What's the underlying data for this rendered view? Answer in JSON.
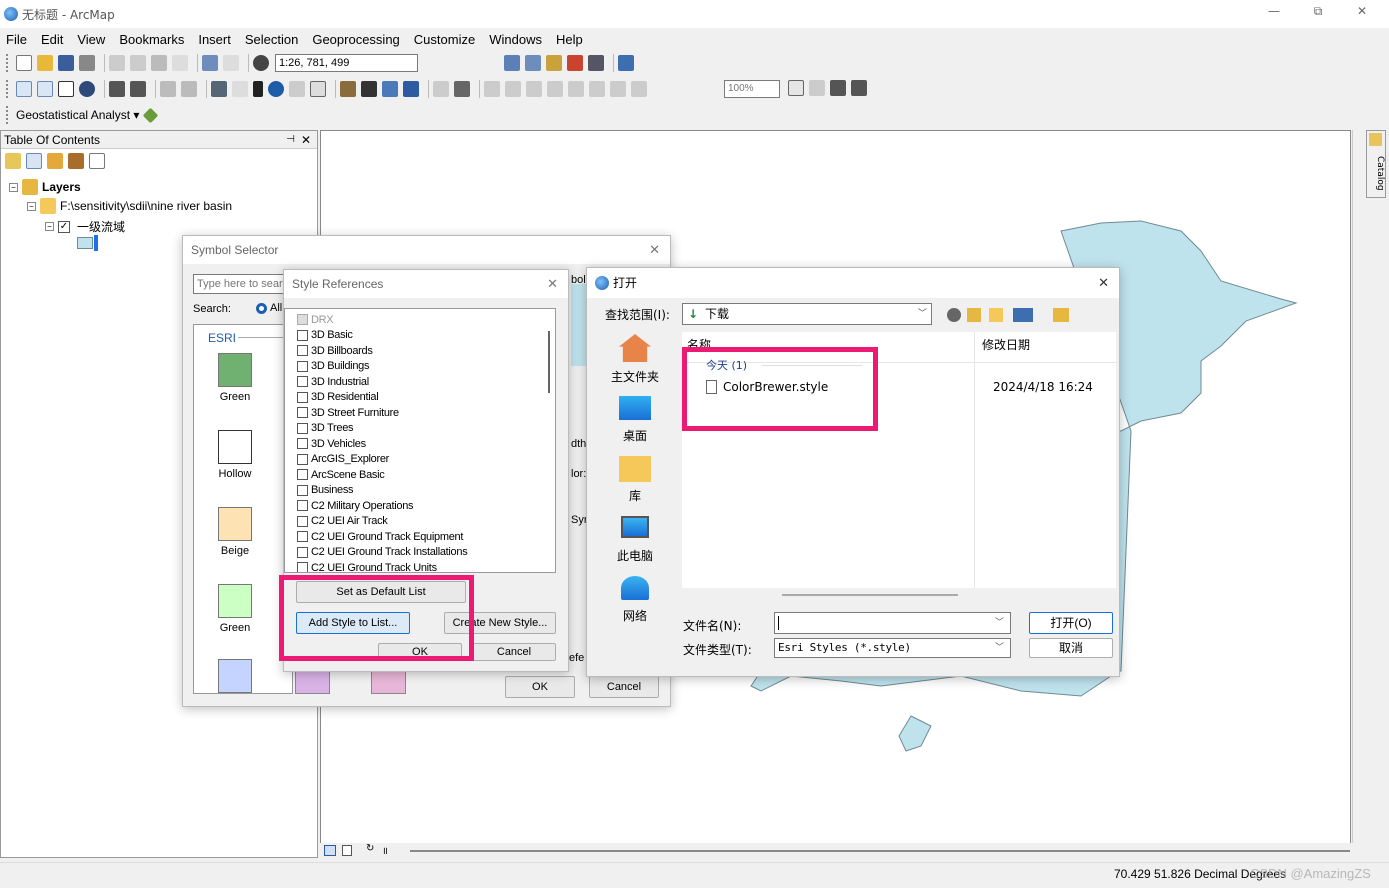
{
  "window": {
    "title": "无标题 - ArcMap",
    "controls": [
      "—",
      "⧉",
      "✕"
    ]
  },
  "menu": [
    "File",
    "Edit",
    "View",
    "Bookmarks",
    "Insert",
    "Selection",
    "Geoprocessing",
    "Customize",
    "Windows",
    "Help"
  ],
  "toolbar": {
    "scale": "1:26, 781, 499",
    "zoom": "100%",
    "geostat": "Geostatistical Analyst ▾"
  },
  "toc": {
    "title": "Table Of Contents",
    "layers_label": "Layers",
    "folder": "F:\\sensitivity\\sdii\\nine river basin",
    "layer": "一级流域"
  },
  "catalog_tab": "Catalog",
  "symbol_selector": {
    "title": "Symbol Selector",
    "search_placeholder": "Type here to search",
    "search_label": "Search:",
    "all_label": "All",
    "group": "ESRI",
    "symbols": [
      {
        "name": "Green",
        "color": "#70b070"
      },
      {
        "name": "Hollow",
        "color": "#ffffff"
      },
      {
        "name": "Beige",
        "color": "#fde3b4"
      },
      {
        "name": "Green",
        "color": "#ccffc4"
      }
    ],
    "partial_labels": [
      "bol",
      "dth",
      "lor:",
      "Sym",
      "efe"
    ],
    "ok": "OK",
    "cancel": "Cancel"
  },
  "style_references": {
    "title": "Style References",
    "items": [
      {
        "label": "DRX",
        "checked": true,
        "disabled": true
      },
      {
        "label": "3D Basic"
      },
      {
        "label": "3D Billboards"
      },
      {
        "label": "3D Buildings"
      },
      {
        "label": "3D Industrial"
      },
      {
        "label": "3D Residential"
      },
      {
        "label": "3D Street Furniture"
      },
      {
        "label": "3D Trees"
      },
      {
        "label": "3D Vehicles"
      },
      {
        "label": "ArcGIS_Explorer"
      },
      {
        "label": "ArcScene Basic"
      },
      {
        "label": "Business"
      },
      {
        "label": "C2 Military Operations"
      },
      {
        "label": "C2 UEI Air Track"
      },
      {
        "label": "C2 UEI Ground Track Equipment"
      },
      {
        "label": "C2 UEI Ground Track Installations"
      },
      {
        "label": "C2 UEI Ground Track Units"
      }
    ],
    "set_default": "Set as Default List",
    "add_style": "Add Style to List...",
    "create_new": "Create New Style...",
    "ok": "OK",
    "cancel": "Cancel"
  },
  "open_dialog": {
    "title": "打开",
    "lookin_label": "查找范围(I):",
    "lookin_value": "下载",
    "places": [
      "主文件夹",
      "桌面",
      "库",
      "此电脑",
      "网络"
    ],
    "col_name": "名称",
    "col_date": "修改日期",
    "group": "今天 (1)",
    "files": [
      {
        "name": "ColorBrewer.style",
        "date": "2024/4/18 16:24"
      }
    ],
    "filename_label": "文件名(N):",
    "filename_value": "",
    "filetype_label": "文件类型(T):",
    "filetype_value": "Esri Styles (*.style)",
    "open_btn": "打开(O)",
    "cancel_btn": "取消"
  },
  "status": {
    "coords": "70.429  51.826 Decimal Degrees",
    "watermark": "CSDN @AmazingZS"
  },
  "colors": {
    "accent_highlight": "#ec1a73",
    "map_fill": "#bfe3ed",
    "map_stroke": "#6f8a94"
  }
}
